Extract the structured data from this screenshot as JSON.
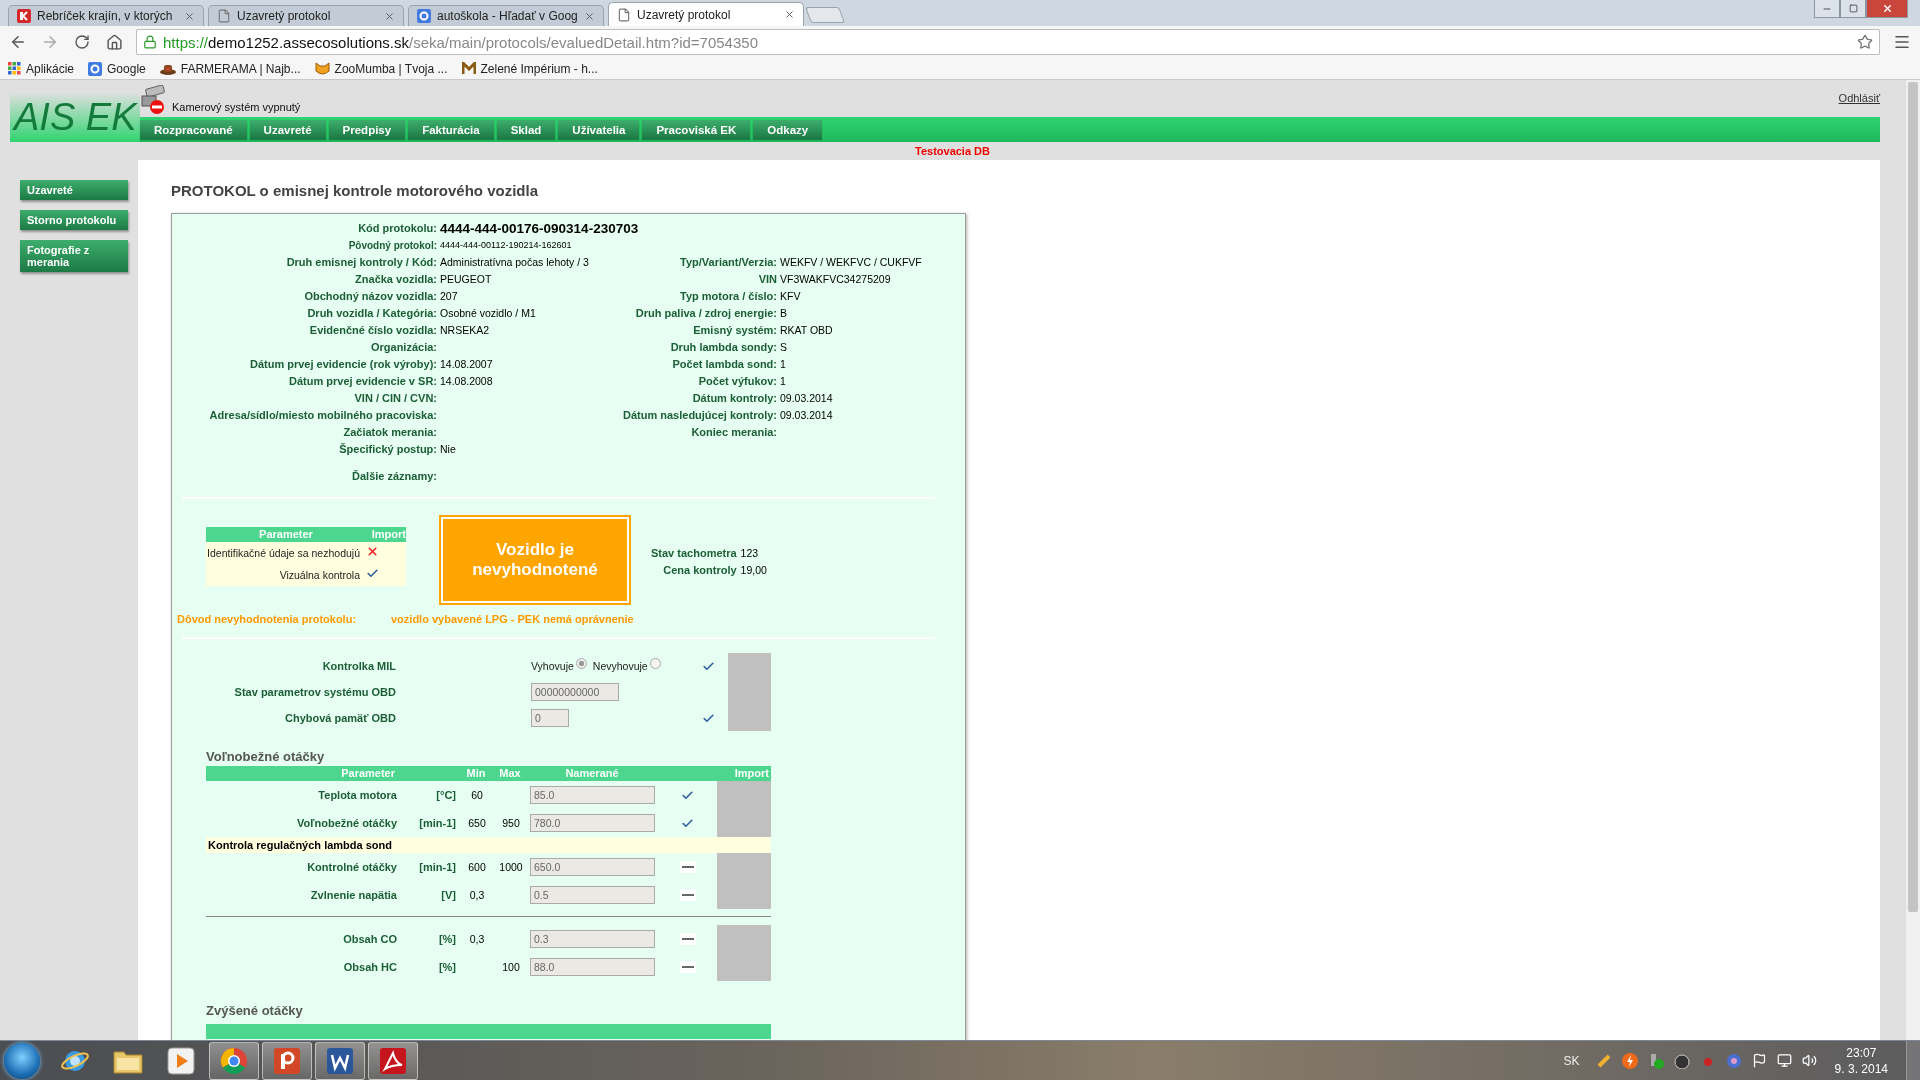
{
  "browser": {
    "tabs": [
      {
        "title": "Rebríček krajín, v ktorých",
        "kind": "brand",
        "selected": false
      },
      {
        "title": "Uzavretý protokol",
        "kind": "page",
        "selected": false
      },
      {
        "title": "autoškola - Hľadať v Goog",
        "kind": "google",
        "selected": false
      },
      {
        "title": "Uzavretý protokol",
        "kind": "page",
        "selected": true
      }
    ],
    "url": {
      "scheme": "https://",
      "host": "demo1252.assecosolutions.sk",
      "path": "/seka/main/protocols/evaluedDetail.htm?id=7054350"
    },
    "bookmarks": [
      {
        "label": "Aplikácie",
        "kind": "apps"
      },
      {
        "label": "Google",
        "kind": "google"
      },
      {
        "label": "FARMERAMA | Najb...",
        "kind": "hat"
      },
      {
        "label": "ZooMumba | Tvoja ...",
        "kind": "cat"
      },
      {
        "label": "Zelené Impérium - h...",
        "kind": "mark"
      }
    ]
  },
  "header": {
    "logo": "AIS EK",
    "camera_status": "Kamerový systém vypnutý",
    "logout": "Odhlásiť",
    "environment": "Testovacia DB",
    "menu": [
      "Rozpracované",
      "Uzavreté",
      "Predpisy",
      "Fakturácia",
      "Sklad",
      "Užívatelia",
      "Pracoviská EK",
      "Odkazy"
    ]
  },
  "sidebar": [
    "Uzavreté",
    "Storno protokolu",
    "Fotografie z merania"
  ],
  "title": "PROTOKOL o emisnej kontrole motorového vozidla",
  "details": [
    {
      "kind": "code",
      "label": "Kód protokolu:",
      "value": "4444-444-00176-090314-230703"
    },
    {
      "kind": "small",
      "label": "Pôvodný protokol:",
      "value": "4444-444-00112-190214-162601"
    },
    {
      "kind": "field",
      "label": "Druh emisnej kontroly / Kód:",
      "value": "Administratívna počas lehoty / 3",
      "right_label": "Typ/Variant/Verzia:",
      "right_value": "WEKFV / WEKFVC / CUKFVF"
    },
    {
      "kind": "field",
      "label": "Značka vozidla:",
      "value": "PEUGEOT",
      "right_label": "VIN",
      "right_value": "VF3WAKFVC34275209"
    },
    {
      "kind": "field",
      "label": "Obchodný názov vozidla:",
      "value": "207",
      "right_label": "Typ motora / číslo:",
      "right_value": "KFV"
    },
    {
      "kind": "field",
      "label": "Druh vozidla / Kategória:",
      "value": "Osobné vozidlo / M1",
      "right_label": "Druh paliva / zdroj energie:",
      "right_value": "B"
    },
    {
      "kind": "field",
      "label": "Evidenčné číslo vozidla:",
      "value": "NRSEKA2",
      "right_label": "Emisný systém:",
      "right_value": "RKAT OBD"
    },
    {
      "kind": "field",
      "label": "Organizácia:",
      "right_label": "Druh lambda sondy:",
      "right_value": "S"
    },
    {
      "kind": "field",
      "label": "Dátum prvej evidencie (rok výroby):",
      "value": "14.08.2007",
      "right_label": "Počet lambda sond:",
      "right_value": "1"
    },
    {
      "kind": "field",
      "label": "Dátum prvej evidencie v SR:",
      "value": "14.08.2008",
      "right_label": "Počet výfukov:",
      "right_value": "1"
    },
    {
      "kind": "field",
      "label": "VIN / CIN / CVN:",
      "right_label": "Dátum kontroly:",
      "right_value": "09.03.2014"
    },
    {
      "kind": "field",
      "label": "Adresa/sídlo/miesto mobilného pracoviska:",
      "right_label": "Dátum nasledujúcej kontroly:",
      "right_value": "09.03.2014"
    },
    {
      "kind": "field",
      "label": "Začiatok merania:",
      "right_label": "Koniec merania:"
    },
    {
      "kind": "field",
      "label": "Špecifický postup:",
      "value": "Nie"
    },
    {
      "kind": "spaced",
      "label": "Ďalšie záznamy:"
    }
  ],
  "checks": {
    "columns": [
      "Parameter",
      "Import"
    ],
    "rows": [
      {
        "label": "Identifikačné údaje sa nezhodujú",
        "ok": false
      },
      {
        "label": "Vizuálna kontrola",
        "ok": true
      }
    ]
  },
  "verdict": "Vozidlo je nevyhodnotené",
  "stats": [
    {
      "label": "Stav tachometra",
      "value": "123"
    },
    {
      "label": "Cena kontroly",
      "value": "19,00"
    }
  ],
  "reason": {
    "label": "Dôvod nevyhodnotenia protokolu:",
    "text": "vozidlo vybavené LPG - PEK nemá oprávnenie"
  },
  "obd": [
    {
      "kind": "radio",
      "label": "Kontrolka MIL",
      "options": [
        {
          "label": "Vyhovuje",
          "selected": true
        },
        {
          "label": "Nevyhovuje",
          "selected": false
        }
      ],
      "checked": true
    },
    {
      "kind": "input",
      "label": "Stav parametrov systému OBD",
      "value": "00000000000",
      "checked": false
    },
    {
      "kind": "short",
      "label": "Chybová pamäť OBD",
      "value": "0",
      "checked": true
    }
  ],
  "idle": {
    "heading": "Voľnobežné otáčky",
    "columns": [
      "Parameter",
      "Min",
      "Max",
      "Namerané",
      "Import"
    ],
    "rows": [
      {
        "kind": "param",
        "label": "Teplota motora",
        "unit": "[°C]",
        "min": "60",
        "measured": "85.0",
        "imported": true
      },
      {
        "kind": "param",
        "label": "Voľnobežné otáčky",
        "unit": "[min-1]",
        "min": "650",
        "max": "950",
        "measured": "780.0",
        "imported": true
      },
      {
        "kind": "subheading",
        "label": "Kontrola regulačných lambda sond"
      },
      {
        "kind": "param",
        "label": "Kontrolné otáčky",
        "unit": "[min-1]",
        "min": "600",
        "max": "1000",
        "measured": "650.0",
        "imported": false
      },
      {
        "kind": "param",
        "label": "Zvlnenie napätia",
        "unit": "[V]",
        "min": "0,3",
        "measured": "0.5",
        "imported": false
      },
      {
        "kind": "divider"
      },
      {
        "kind": "param",
        "label": "Obsah CO",
        "unit": "[%]",
        "min": "0,3",
        "measured": "0.3",
        "imported": false
      },
      {
        "kind": "param",
        "label": "Obsah HC",
        "unit": "[%]",
        "max": "100",
        "measured": "88.0",
        "imported": false
      }
    ]
  },
  "raised": {
    "heading": "Zvýšené otáčky"
  },
  "taskbar": {
    "apps": [
      {
        "kind": "ie",
        "running": false
      },
      {
        "kind": "folder",
        "running": false
      },
      {
        "kind": "media",
        "running": false
      },
      {
        "kind": "chrome",
        "running": true
      },
      {
        "kind": "slides",
        "running": true
      },
      {
        "kind": "doc",
        "running": true
      },
      {
        "kind": "pdf",
        "running": true
      }
    ],
    "language": "SK",
    "time": "23:07",
    "date": "9. 3. 2014"
  }
}
